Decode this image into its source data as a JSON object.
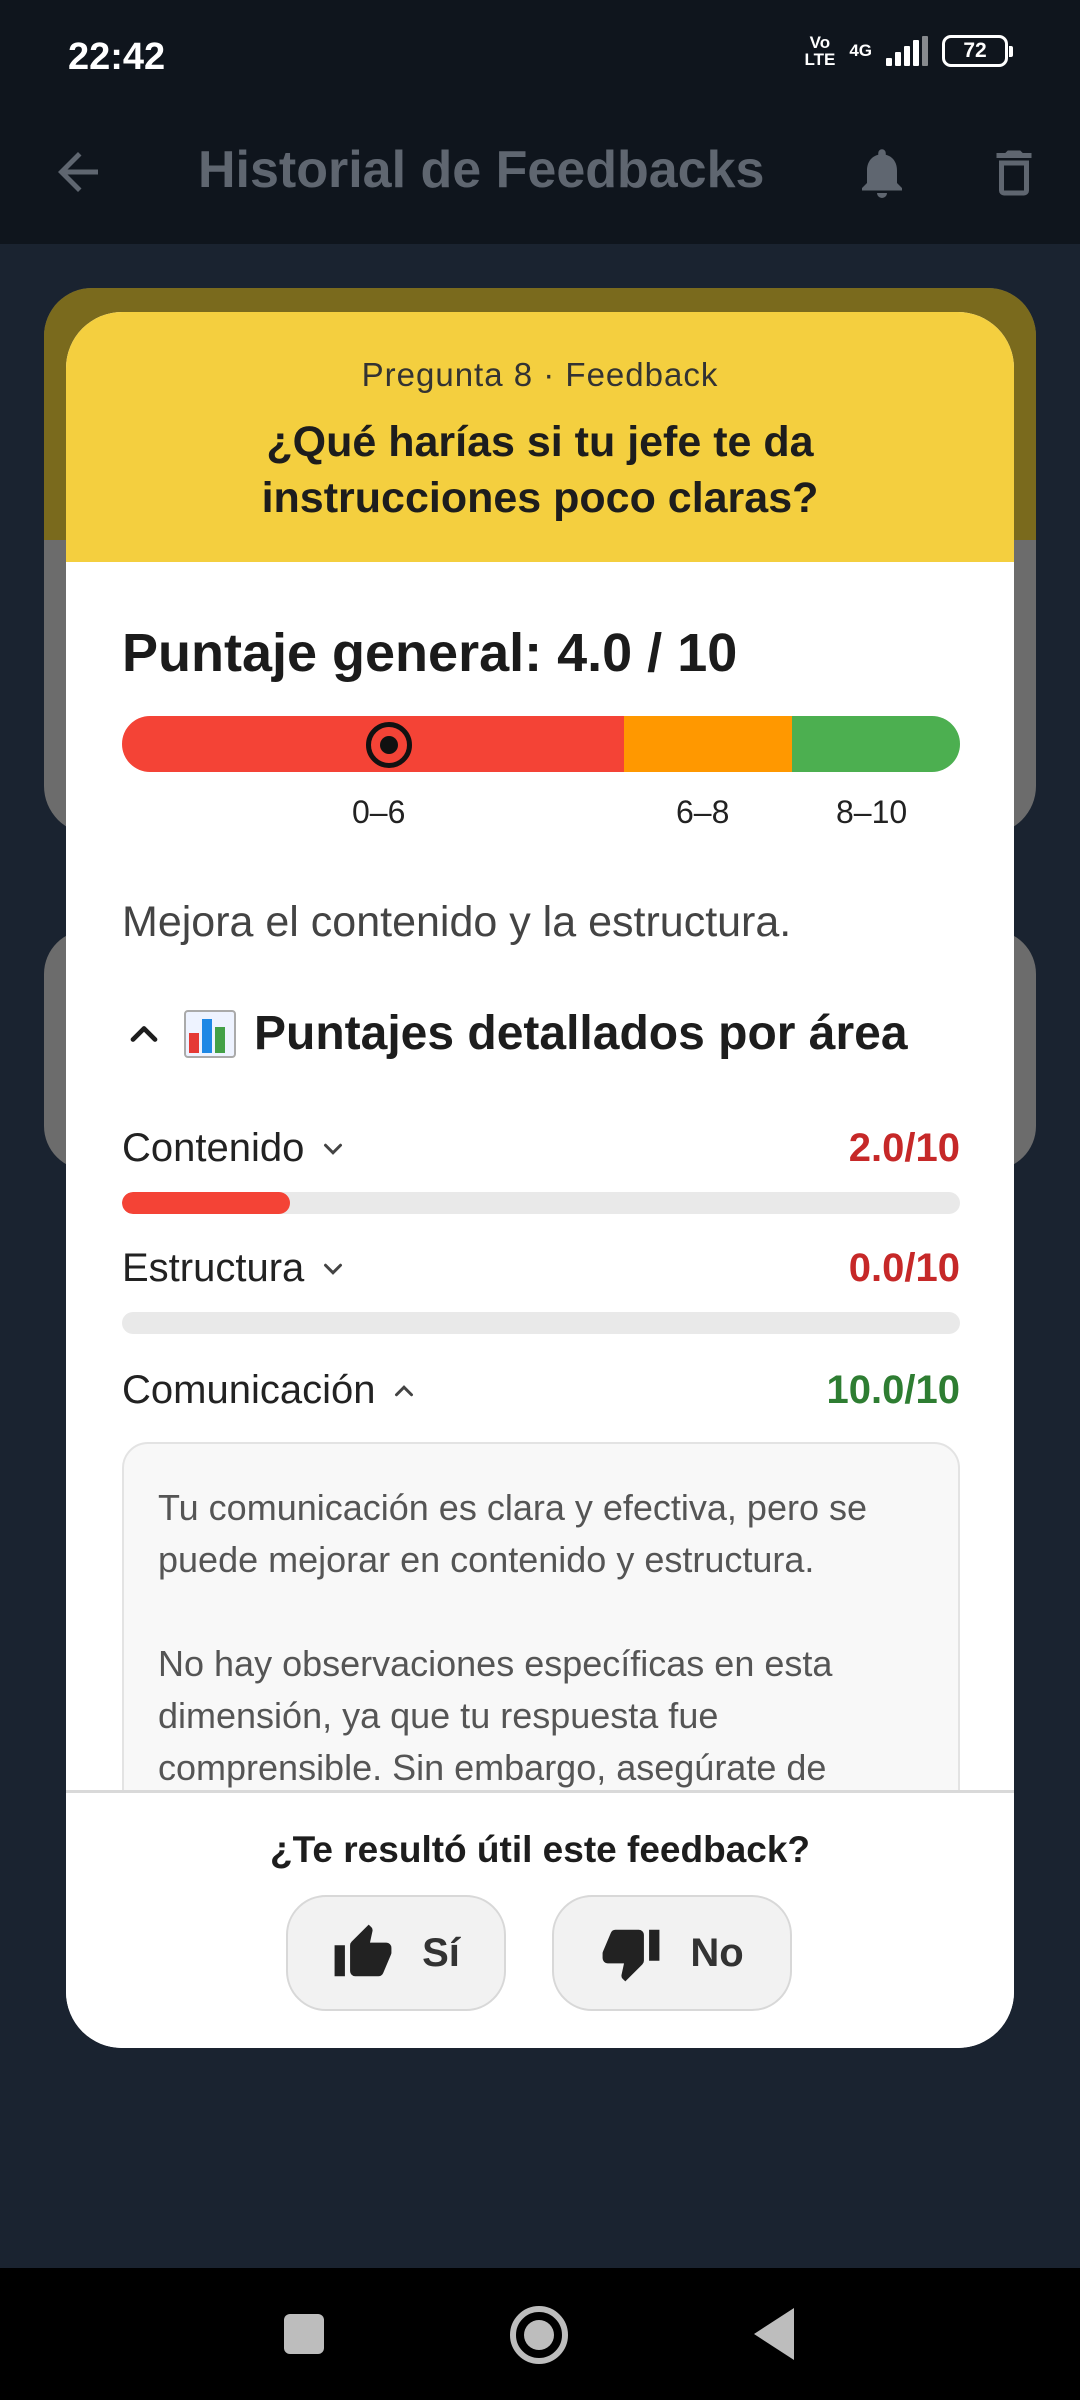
{
  "status_bar": {
    "time": "22:42",
    "volte_top": "Vo",
    "volte_bottom": "LTE",
    "network": "4G",
    "battery": "72"
  },
  "app_bar": {
    "title": "Historial de Feedbacks",
    "back_icon": "arrow-left-icon",
    "bell_icon": "bell-icon",
    "trash_icon": "trash-icon"
  },
  "modal": {
    "question_number": "Pregunta 8 · Feedback",
    "question_title": "¿Qué harías si tu jefe te da instrucciones poco claras?",
    "score_title": "Puntaje general: 4.0 / 10",
    "score_value": 4.0,
    "score_max": 10,
    "ranges": [
      "0–6",
      "6–8",
      "8–10"
    ],
    "range_colors": {
      "low": "#f44336",
      "mid": "#ff9800",
      "high": "#4caf50"
    },
    "summary": "Mejora el contenido y la estructura.",
    "section_title": "Puntajes detallados por área",
    "section_icon": "bar-chart-emoji",
    "dimensions": [
      {
        "label": "Contenido",
        "score": "2.0/10",
        "value": 0.2,
        "color": "#c62828",
        "expanded": false
      },
      {
        "label": "Estructura",
        "score": "0.0/10",
        "value": 0.0,
        "color": "#c62828",
        "expanded": false
      },
      {
        "label": "Comunicación",
        "score": "10.0/10",
        "value": 1.0,
        "color": "#2e7d32",
        "expanded": true
      }
    ],
    "detail_paragraphs": [
      "Tu comunicación es clara y efectiva, pero se puede mejorar en contenido y estructura.",
      "No hay observaciones específicas en esta dimensión, ya que tu respuesta fue comprensible. Sin embargo, asegúrate de"
    ],
    "footer_question": "¿Te resultó útil este feedback?",
    "yes_label": "Sí",
    "no_label": "No"
  }
}
